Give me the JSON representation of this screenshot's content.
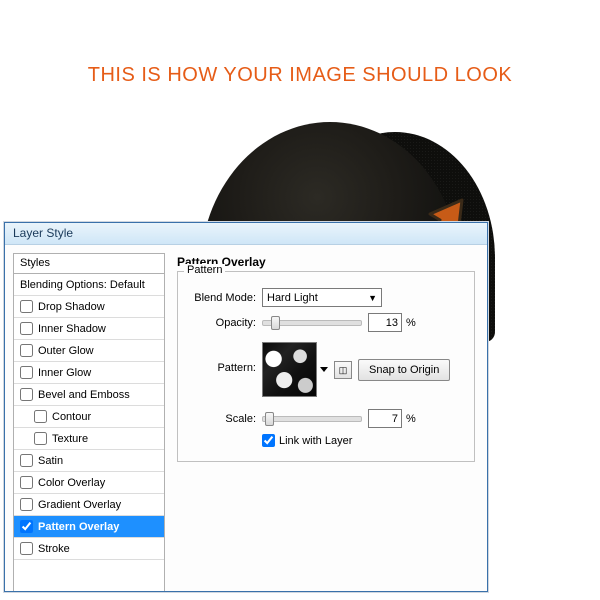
{
  "header": {
    "title": "THIS IS HOW YOUR IMAGE SHOULD LOOK"
  },
  "dialog": {
    "title": "Layer Style",
    "styles_header": "Styles",
    "blending_options": "Blending Options: Default",
    "effects": [
      {
        "label": "Drop Shadow",
        "checked": false
      },
      {
        "label": "Inner Shadow",
        "checked": false
      },
      {
        "label": "Outer Glow",
        "checked": false
      },
      {
        "label": "Inner Glow",
        "checked": false
      },
      {
        "label": "Bevel and Emboss",
        "checked": false
      },
      {
        "label": "Contour",
        "checked": false,
        "indent": true
      },
      {
        "label": "Texture",
        "checked": false,
        "indent": true
      },
      {
        "label": "Satin",
        "checked": false
      },
      {
        "label": "Color Overlay",
        "checked": false
      },
      {
        "label": "Gradient Overlay",
        "checked": false
      },
      {
        "label": "Pattern Overlay",
        "checked": true,
        "selected": true
      },
      {
        "label": "Stroke",
        "checked": false
      }
    ]
  },
  "panel": {
    "title": "Pattern Overlay",
    "subtitle": "Pattern",
    "blend_mode_label": "Blend Mode:",
    "blend_mode_value": "Hard Light",
    "opacity_label": "Opacity:",
    "opacity_value": "13",
    "opacity_unit": "%",
    "pattern_label": "Pattern:",
    "snap_button": "Snap to Origin",
    "scale_label": "Scale:",
    "scale_value": "7",
    "scale_unit": "%",
    "link_label": "Link with Layer",
    "link_checked": true
  }
}
